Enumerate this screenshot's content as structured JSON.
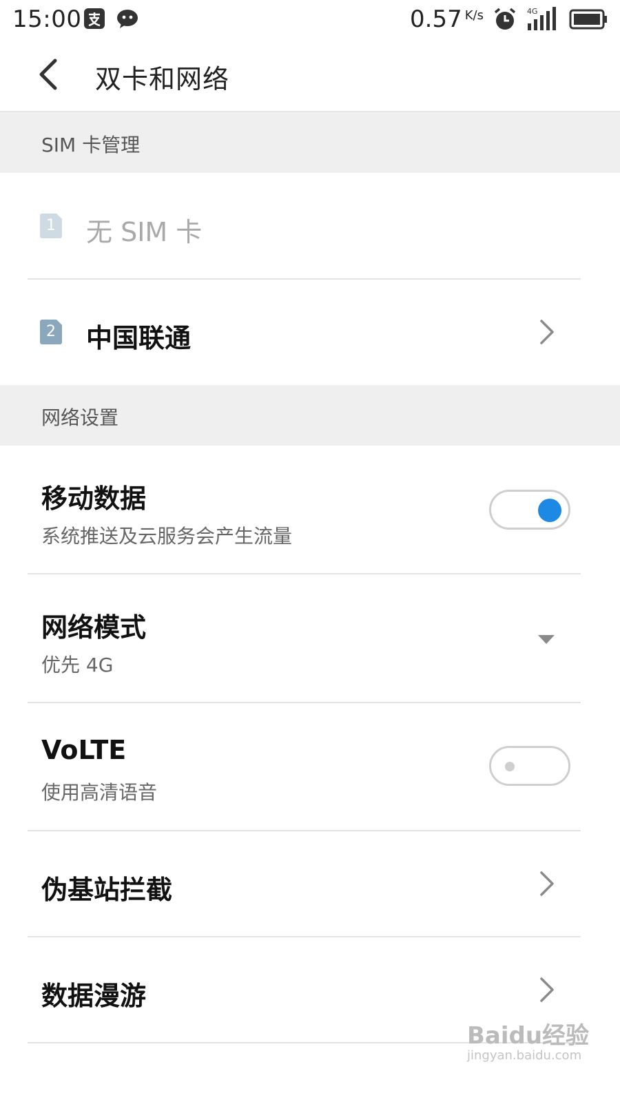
{
  "status_bar": {
    "time": "15:00",
    "network_speed": "0.57",
    "network_speed_unit": "K/s",
    "network_type": "4G",
    "icons": [
      "alipay-icon",
      "wechat-icon",
      "alarm-icon",
      "signal-icon",
      "battery-icon"
    ]
  },
  "header": {
    "title": "双卡和网络"
  },
  "sim_section": {
    "title": "SIM 卡管理",
    "sim1": {
      "badge": "1",
      "label": "无 SIM 卡"
    },
    "sim2": {
      "badge": "2",
      "label": "中国联通"
    }
  },
  "network_section": {
    "title": "网络设置",
    "mobile_data": {
      "title": "移动数据",
      "subtitle": "系统推送及云服务会产生流量",
      "enabled": true
    },
    "network_mode": {
      "title": "网络模式",
      "value": "优先 4G"
    },
    "volte": {
      "title": "VoLTE",
      "subtitle": "使用高清语音",
      "enabled": false
    },
    "fake_base_station": {
      "title": "伪基站拦截"
    },
    "data_roaming": {
      "title": "数据漫游"
    }
  },
  "watermark": {
    "brand": "Baidu经验",
    "url": "jingyan.baidu.com"
  },
  "colors": {
    "accent": "#1e88e5",
    "section_bg": "#efefef",
    "sim_disabled": "#cfdbe3",
    "sim_active": "#8aa7bb"
  }
}
